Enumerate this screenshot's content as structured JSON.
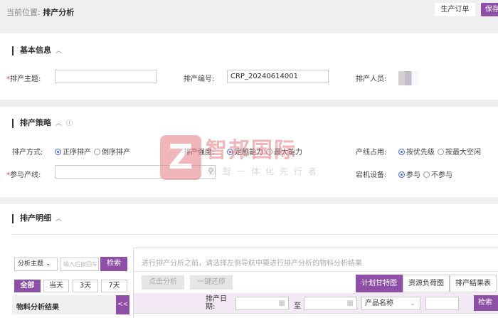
{
  "header": {
    "location_label": "当前位置:",
    "location_value": "排产分析",
    "order_button": "生产订单",
    "save_button": "保存"
  },
  "basic": {
    "title": "基本信息",
    "subject_label": "排产主题:",
    "subject_value": "",
    "code_label": "排产编号:",
    "code_value": "CRP_20240614001",
    "staff_label": "排产人员:"
  },
  "strategy": {
    "title": "排产策略",
    "mode_label": "排产方式:",
    "mode_options": [
      "正序排产",
      "倒序排产"
    ],
    "mode_selected": "正序排产",
    "intensity_label": "排产强度:",
    "intensity_options": [
      "定额能力",
      "最大能力"
    ],
    "intensity_selected": "定额能力",
    "line_use_label": "产线占用:",
    "line_use_options": [
      "按优先级",
      "按最大空闲"
    ],
    "line_use_selected": "按优先级",
    "lines_label": "参与产线:",
    "lines_value": "",
    "down_label": "宕机设备:",
    "down_options": [
      "参与",
      "不参与"
    ],
    "down_selected": "参与"
  },
  "watermark": {
    "brand": "智邦国际",
    "tagline": "数智一体化先行者"
  },
  "detail": {
    "title": "排产明细",
    "left": {
      "filter_select": "分析主题",
      "search_placeholder": "输入后按回车",
      "search_button": "检索",
      "ranges": [
        "全部",
        "当天",
        "3天",
        "7天"
      ],
      "range_selected": "全部",
      "result_title": "物料分析结果",
      "collapse": "<<"
    },
    "right": {
      "hint": "进行排产分析之前，请选择左侧导航中要进行排产分析的物料分析结果",
      "analyze_button": "点击分析",
      "reset_button": "一键还原",
      "views": [
        "计划甘特图",
        "资源负荷图",
        "排产结果表"
      ],
      "view_selected": "计划甘特图",
      "date_label": "排产日期:",
      "to_label": "至",
      "product_select": "产品名称",
      "search_button": "检索"
    }
  }
}
